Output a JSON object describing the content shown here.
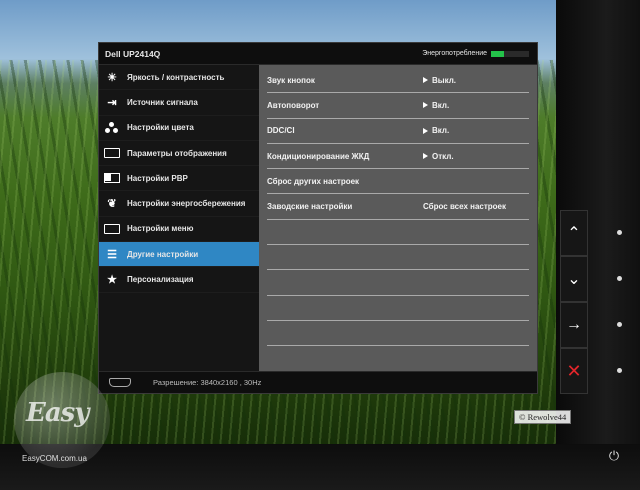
{
  "osd": {
    "title": "Dell UP2414Q",
    "energy": {
      "label": "Энергопотребление",
      "level": 0.35,
      "color": "#24c24a"
    },
    "accent_color": "#2f87c4",
    "menu": [
      {
        "label": "Яркость / контрастность",
        "icon": "brightness-icon"
      },
      {
        "label": "Источник сигнала",
        "icon": "input-source-icon"
      },
      {
        "label": "Настройки цвета",
        "icon": "color-dots-icon"
      },
      {
        "label": "Параметры отображения",
        "icon": "display-rect-icon"
      },
      {
        "label": "Настройки PBP",
        "icon": "pbp-icon"
      },
      {
        "label": "Настройки энергосбережения",
        "icon": "energy-leaf-icon"
      },
      {
        "label": "Настройки меню",
        "icon": "menu-icon"
      },
      {
        "label": "Другие настройки",
        "icon": "sliders-icon",
        "active": true
      },
      {
        "label": "Персонализация",
        "icon": "star-icon"
      }
    ],
    "settings": [
      {
        "label": "Звук кнопок",
        "value": "Выкл.",
        "arrow": true
      },
      {
        "label": "Автоповорот",
        "value": "Вкл.",
        "arrow": true
      },
      {
        "label": "DDC/CI",
        "value": "Вкл.",
        "arrow": true
      },
      {
        "label": "Кондиционирование ЖКД",
        "value": "Откл.",
        "arrow": true
      },
      {
        "label": "Сброс других настроек",
        "value": "",
        "arrow": false
      },
      {
        "label": "Заводские настройки",
        "value": "Сброс всех настроек",
        "arrow": false
      }
    ],
    "empty_rows": 5,
    "footer": {
      "resolution_label": "Разрешение:",
      "resolution_value": "3840x2160 , 30Hz",
      "port_icon": "hdmi-icon"
    }
  },
  "side_buttons": [
    {
      "icon": "chevron-up-icon",
      "glyph": "⌃"
    },
    {
      "icon": "chevron-down-icon",
      "glyph": "⌄"
    },
    {
      "icon": "arrow-right-icon",
      "glyph": "→"
    },
    {
      "icon": "close-icon",
      "glyph": "✕"
    }
  ],
  "power_icon": "power-icon",
  "watermarks": {
    "corner": "© Rewolve44",
    "logo_text": "Easy",
    "site": "EasyCOM.com.ua"
  }
}
